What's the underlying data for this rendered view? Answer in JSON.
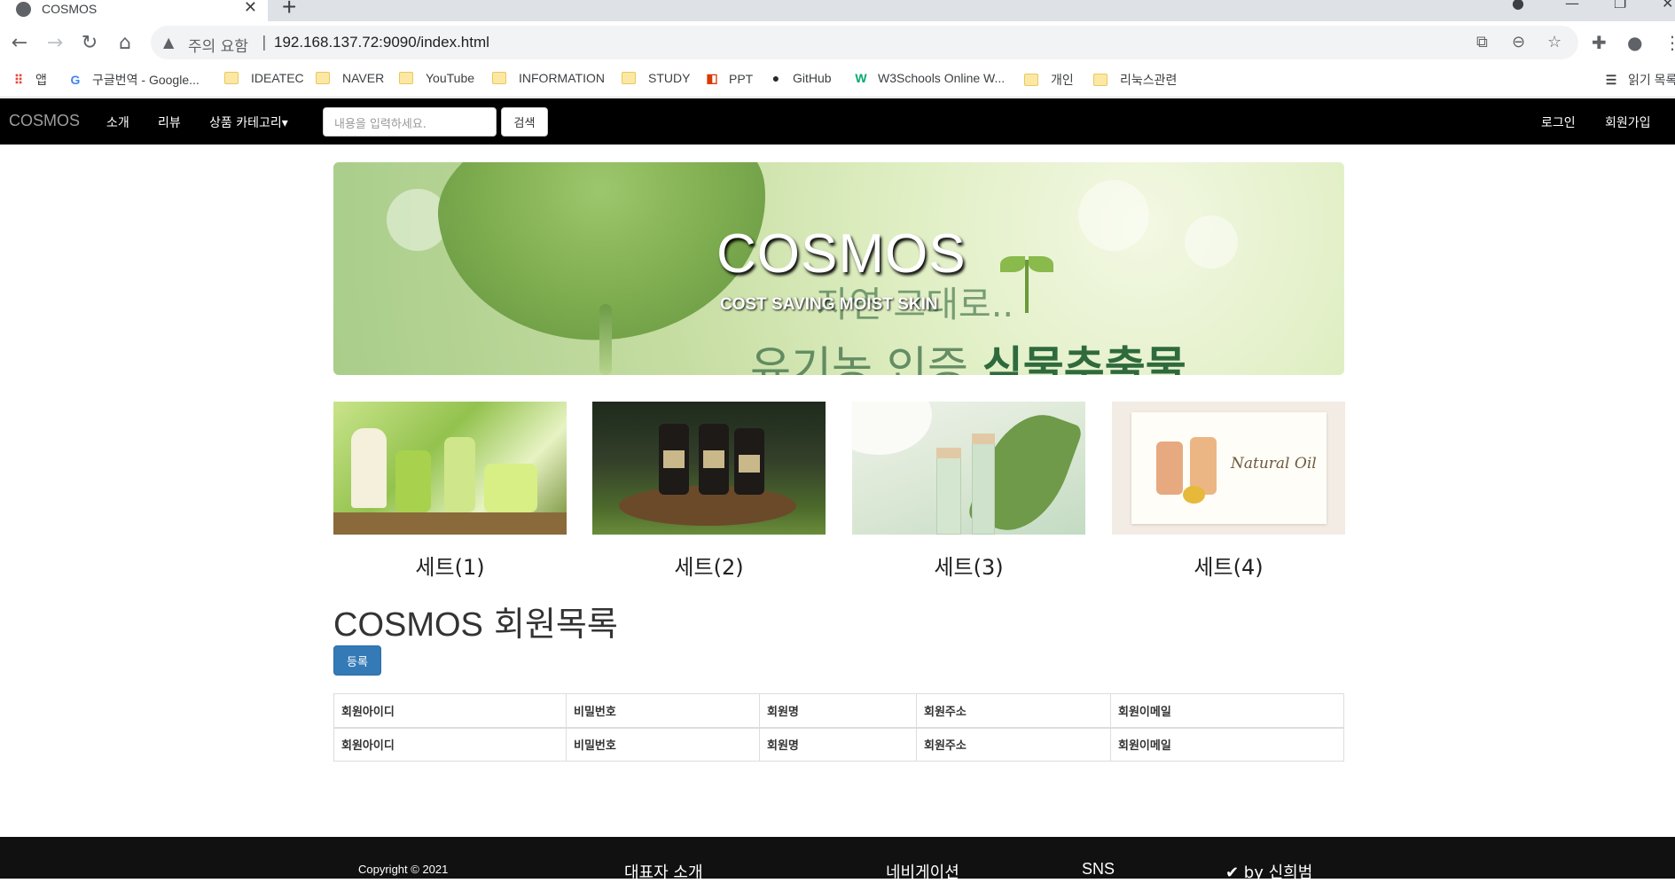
{
  "browser": {
    "tab_title": "COSMOS",
    "warning_text": "주의 요함",
    "url": "192.168.137.72:9090/index.html",
    "bookmarks": [
      "앱",
      "구글번역 - Google...",
      "IDEATEC",
      "NAVER",
      "YouTube",
      "INFORMATION",
      "STUDY",
      "PPT",
      "GitHub",
      "W3Schools Online W...",
      "개인",
      "리눅스관련"
    ],
    "reading_list": "읽기 목록"
  },
  "nav": {
    "brand": "COSMOS",
    "links": [
      "소개",
      "리뷰",
      "상품 카테고리▾"
    ],
    "search_placeholder": "내용을 입력하세요.",
    "search_button": "검색",
    "login": "로그인",
    "signup": "회원가입"
  },
  "banner": {
    "title": "COSMOS",
    "subtitle": "COST SAVING MOIST SKIN",
    "text1": "자연 그대로..",
    "text2_plain": "유기농 인증 ",
    "text2_bold": "식물추출물"
  },
  "products": [
    "세트(1)",
    "세트(2)",
    "세트(3)",
    "세트(4)"
  ],
  "product4_image_text": "Natural Oil",
  "members": {
    "title_en": "COSMOS",
    "title_ko": " 회원목록",
    "register_button": "등록",
    "headers": [
      "회원아이디",
      "비밀번호",
      "회원명",
      "회원주소",
      "회원이메일"
    ],
    "rows": [
      [
        "회원아이디",
        "비밀번호",
        "회원명",
        "회원주소",
        "회원이메일"
      ]
    ]
  },
  "footer": {
    "copyright": "Copyright © 2021",
    "about": "대표자 소개",
    "navigation": "네비게이션",
    "sns": "SNS",
    "author": "✔ by 신희범"
  }
}
